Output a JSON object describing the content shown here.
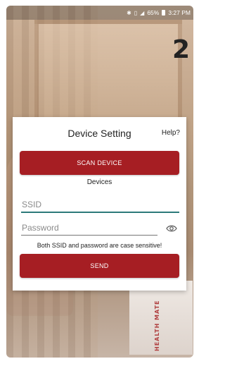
{
  "status_bar": {
    "battery": "65%",
    "time": "3:27 PM"
  },
  "step_number": "2",
  "towel_text": "HEALTH MATE",
  "dialog": {
    "title": "Device Setting",
    "help_label": "Help?",
    "scan_button_label": "SCAN DEVICE",
    "devices_label": "Devices",
    "ssid": {
      "placeholder": "SSID",
      "value": ""
    },
    "password": {
      "placeholder": "Password",
      "value": ""
    },
    "hint": "Both SSID and password are case sensitive!",
    "send_button_label": "SEND"
  },
  "colors": {
    "accent": "#a61e23",
    "ssid_underline": "#2c7a7a"
  },
  "icons": [
    "bluetooth-icon",
    "vibrate-icon",
    "signal-icon",
    "battery-icon",
    "eye-icon"
  ]
}
